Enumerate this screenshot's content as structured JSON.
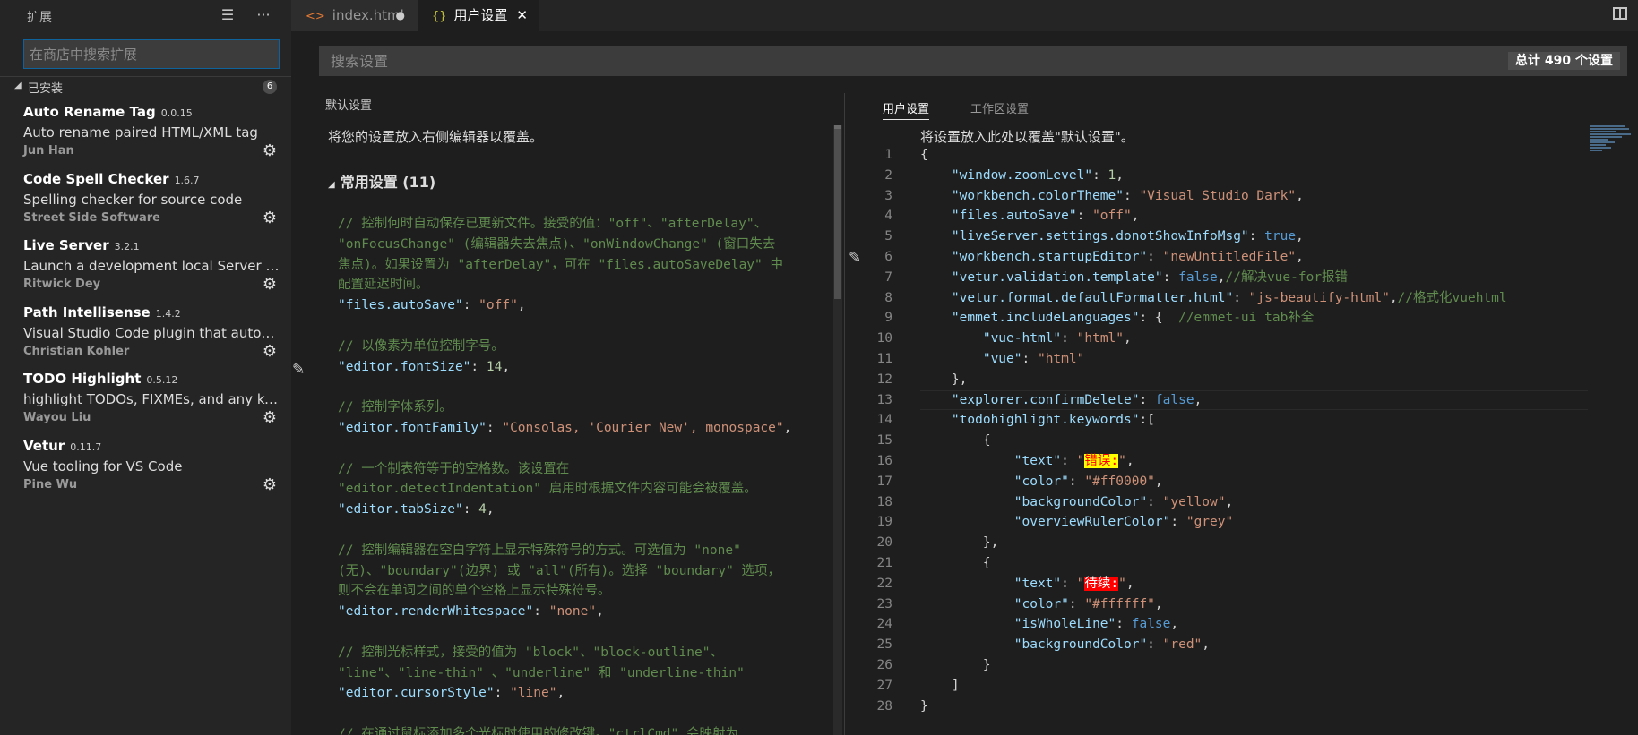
{
  "sidebar": {
    "title": "扩展",
    "search_placeholder": "在商店中搜索扩展",
    "installed_label": "已安装",
    "installed_count": "6",
    "extensions": [
      {
        "name": "Auto Rename Tag",
        "version": "0.0.15",
        "description": "Auto rename paired HTML/XML tag",
        "author": "Jun Han"
      },
      {
        "name": "Code Spell Checker",
        "version": "1.6.7",
        "description": "Spelling checker for source code",
        "author": "Street Side Software"
      },
      {
        "name": "Live Server",
        "version": "3.2.1",
        "description": "Launch a development local Server with...",
        "author": "Ritwick Dey"
      },
      {
        "name": "Path Intellisense",
        "version": "1.4.2",
        "description": "Visual Studio Code plugin that autocom...",
        "author": "Christian Kohler"
      },
      {
        "name": "TODO Highlight",
        "version": "0.5.12",
        "description": "highlight TODOs, FIXMEs, and any keyw...",
        "author": "Wayou Liu"
      },
      {
        "name": "Vetur",
        "version": "0.11.7",
        "description": "Vue tooling for VS Code",
        "author": "Pine Wu"
      }
    ]
  },
  "tabs": [
    {
      "label": "index.html",
      "icon": "html-icon"
    },
    {
      "label": "用户设置",
      "icon": "json-icon"
    }
  ],
  "settings": {
    "search_placeholder": "搜索设置",
    "total": "总计 490 个设置",
    "default_title": "默认设置",
    "default_note": "将您的设置放入右侧编辑器以覆盖。",
    "group_label": "常用设置 (11)",
    "user_tab": "用户设置",
    "workspace_tab": "工作区设置",
    "user_note": "将设置放入此处以覆盖\"默认设置\"。"
  },
  "default_code": [
    {
      "t": "cmt",
      "v": "// 控制何时自动保存已更新文件。接受的值：\"off\"、\"afterDelay\"、"
    },
    {
      "t": "cmt",
      "v": "\"onFocusChange\" (编辑器失去焦点)、\"onWindowChange\" (窗口失去"
    },
    {
      "t": "cmt",
      "v": "焦点)。如果设置为 \"afterDelay\"，可在 \"files.autoSaveDelay\" 中"
    },
    {
      "t": "cmt",
      "v": "配置延迟时间。"
    },
    {
      "t": "kv",
      "k": "\"files.autoSave\"",
      "vt": "str",
      "v": "\"off\""
    },
    {
      "t": "blank",
      "v": ""
    },
    {
      "t": "cmt",
      "v": "// 以像素为单位控制字号。"
    },
    {
      "t": "kv",
      "k": "\"editor.fontSize\"",
      "vt": "num",
      "v": "14"
    },
    {
      "t": "blank",
      "v": ""
    },
    {
      "t": "cmt",
      "v": "// 控制字体系列。"
    },
    {
      "t": "kv",
      "k": "\"editor.fontFamily\"",
      "vt": "str",
      "v": "\"Consolas, 'Courier New', monospace\""
    },
    {
      "t": "blank",
      "v": ""
    },
    {
      "t": "cmt",
      "v": "// 一个制表符等于的空格数。该设置在"
    },
    {
      "t": "cmt",
      "v": "\"editor.detectIndentation\" 启用时根据文件内容可能会被覆盖。"
    },
    {
      "t": "kv",
      "k": "\"editor.tabSize\"",
      "vt": "num",
      "v": "4"
    },
    {
      "t": "blank",
      "v": ""
    },
    {
      "t": "cmt",
      "v": "// 控制编辑器在空白字符上显示特殊符号的方式。可选值为 \"none\""
    },
    {
      "t": "cmt",
      "v": "(无)、\"boundary\"(边界) 或 \"all\"(所有)。选择 \"boundary\" 选项，"
    },
    {
      "t": "cmt",
      "v": "则不会在单词之间的单个空格上显示特殊符号。"
    },
    {
      "t": "kv",
      "k": "\"editor.renderWhitespace\"",
      "vt": "str",
      "v": "\"none\""
    },
    {
      "t": "blank",
      "v": ""
    },
    {
      "t": "cmt",
      "v": "// 控制光标样式，接受的值为 \"block\"、\"block-outline\"、"
    },
    {
      "t": "cmt",
      "v": "\"line\"、\"line-thin\" 、\"underline\" 和 \"underline-thin\""
    },
    {
      "t": "kv",
      "k": "\"editor.cursorStyle\"",
      "vt": "str",
      "v": "\"line\""
    },
    {
      "t": "blank",
      "v": ""
    },
    {
      "t": "cmt",
      "v": "// 在通过鼠标添加多个光标时使用的修改键。\"ctrlCmd\" 会映射为"
    }
  ],
  "user_code": [
    {
      "n": "1",
      "segs": [
        [
          "pun",
          "{"
        ]
      ]
    },
    {
      "n": "2",
      "segs": [
        [
          "pun",
          "    "
        ],
        [
          "key",
          "\"window.zoomLevel\""
        ],
        [
          "pun",
          ": "
        ],
        [
          "num",
          "1"
        ],
        [
          "pun",
          ","
        ]
      ]
    },
    {
      "n": "3",
      "segs": [
        [
          "pun",
          "    "
        ],
        [
          "key",
          "\"workbench.colorTheme\""
        ],
        [
          "pun",
          ": "
        ],
        [
          "str",
          "\"Visual Studio Dark\""
        ],
        [
          "pun",
          ","
        ]
      ]
    },
    {
      "n": "4",
      "segs": [
        [
          "pun",
          "    "
        ],
        [
          "key",
          "\"files.autoSave\""
        ],
        [
          "pun",
          ": "
        ],
        [
          "str",
          "\"off\""
        ],
        [
          "pun",
          ","
        ]
      ]
    },
    {
      "n": "5",
      "segs": [
        [
          "pun",
          "    "
        ],
        [
          "key",
          "\"liveServer.settings.donotShowInfoMsg\""
        ],
        [
          "pun",
          ": "
        ],
        [
          "kw",
          "true"
        ],
        [
          "pun",
          ","
        ]
      ]
    },
    {
      "n": "6",
      "segs": [
        [
          "pun",
          "    "
        ],
        [
          "key",
          "\"workbench.startupEditor\""
        ],
        [
          "pun",
          ": "
        ],
        [
          "str",
          "\"newUntitledFile\""
        ],
        [
          "pun",
          ","
        ]
      ]
    },
    {
      "n": "7",
      "segs": [
        [
          "pun",
          "    "
        ],
        [
          "key",
          "\"vetur.validation.template\""
        ],
        [
          "pun",
          ": "
        ],
        [
          "kw",
          "false"
        ],
        [
          "pun",
          ","
        ],
        [
          "cmt",
          "//解决vue-for报错"
        ]
      ]
    },
    {
      "n": "8",
      "segs": [
        [
          "pun",
          "    "
        ],
        [
          "key",
          "\"vetur.format.defaultFormatter.html\""
        ],
        [
          "pun",
          ": "
        ],
        [
          "str",
          "\"js-beautify-html\""
        ],
        [
          "pun",
          ","
        ],
        [
          "cmt",
          "//格式化vuehtml"
        ]
      ]
    },
    {
      "n": "9",
      "segs": [
        [
          "pun",
          "    "
        ],
        [
          "key",
          "\"emmet.includeLanguages\""
        ],
        [
          "pun",
          ": {  "
        ],
        [
          "cmt",
          "//emmet-ui tab补全"
        ]
      ]
    },
    {
      "n": "10",
      "segs": [
        [
          "pun",
          "        "
        ],
        [
          "key",
          "\"vue-html\""
        ],
        [
          "pun",
          ": "
        ],
        [
          "str",
          "\"html\""
        ],
        [
          "pun",
          ","
        ]
      ]
    },
    {
      "n": "11",
      "segs": [
        [
          "pun",
          "        "
        ],
        [
          "key",
          "\"vue\""
        ],
        [
          "pun",
          ": "
        ],
        [
          "str",
          "\"html\""
        ]
      ]
    },
    {
      "n": "12",
      "segs": [
        [
          "pun",
          "    },"
        ]
      ]
    },
    {
      "n": "13",
      "segs": [
        [
          "pun",
          "    "
        ],
        [
          "key",
          "\"explorer.confirmDelete\""
        ],
        [
          "pun",
          ": "
        ],
        [
          "kw",
          "false"
        ],
        [
          "pun",
          ","
        ]
      ]
    },
    {
      "n": "14",
      "segs": [
        [
          "pun",
          "    "
        ],
        [
          "key",
          "\"todohighlight.keywords\""
        ],
        [
          "pun",
          ":["
        ]
      ]
    },
    {
      "n": "15",
      "segs": [
        [
          "pun",
          "        {"
        ]
      ]
    },
    {
      "n": "16",
      "segs": [
        [
          "pun",
          "            "
        ],
        [
          "key",
          "\"text\""
        ],
        [
          "pun",
          ": "
        ],
        [
          "str",
          "\""
        ],
        [
          "hly",
          "错误:"
        ],
        [
          "str",
          "\""
        ],
        [
          "pun",
          ","
        ]
      ]
    },
    {
      "n": "17",
      "segs": [
        [
          "pun",
          "            "
        ],
        [
          "key",
          "\"color\""
        ],
        [
          "pun",
          ": "
        ],
        [
          "str",
          "\"#ff0000\""
        ],
        [
          "pun",
          ","
        ]
      ]
    },
    {
      "n": "18",
      "segs": [
        [
          "pun",
          "            "
        ],
        [
          "key",
          "\"backgroundColor\""
        ],
        [
          "pun",
          ": "
        ],
        [
          "str",
          "\"yellow\""
        ],
        [
          "pun",
          ","
        ]
      ]
    },
    {
      "n": "19",
      "segs": [
        [
          "pun",
          "            "
        ],
        [
          "key",
          "\"overviewRulerColor\""
        ],
        [
          "pun",
          ": "
        ],
        [
          "str",
          "\"grey\""
        ]
      ]
    },
    {
      "n": "20",
      "segs": [
        [
          "pun",
          "        },"
        ]
      ]
    },
    {
      "n": "21",
      "segs": [
        [
          "pun",
          "        {"
        ]
      ]
    },
    {
      "n": "22",
      "segs": [
        [
          "pun",
          "            "
        ],
        [
          "key",
          "\"text\""
        ],
        [
          "pun",
          ": "
        ],
        [
          "str",
          "\""
        ],
        [
          "hlr",
          "待续:"
        ],
        [
          "str",
          "\""
        ],
        [
          "pun",
          ","
        ]
      ]
    },
    {
      "n": "23",
      "segs": [
        [
          "pun",
          "            "
        ],
        [
          "key",
          "\"color\""
        ],
        [
          "pun",
          ": "
        ],
        [
          "str",
          "\"#ffffff\""
        ],
        [
          "pun",
          ","
        ]
      ]
    },
    {
      "n": "24",
      "segs": [
        [
          "pun",
          "            "
        ],
        [
          "key",
          "\"isWholeLine\""
        ],
        [
          "pun",
          ": "
        ],
        [
          "kw",
          "false"
        ],
        [
          "pun",
          ","
        ]
      ]
    },
    {
      "n": "25",
      "segs": [
        [
          "pun",
          "            "
        ],
        [
          "key",
          "\"backgroundColor\""
        ],
        [
          "pun",
          ": "
        ],
        [
          "str",
          "\"red\""
        ],
        [
          "pun",
          ","
        ]
      ]
    },
    {
      "n": "26",
      "segs": [
        [
          "pun",
          "        }"
        ]
      ]
    },
    {
      "n": "27",
      "segs": [
        [
          "pun",
          "    ]"
        ]
      ]
    },
    {
      "n": "28",
      "segs": [
        [
          "pun",
          "}"
        ]
      ]
    }
  ],
  "colors": {
    "accent": "#0e639c",
    "background": "#1e1e1e",
    "sidebar": "#252526"
  }
}
